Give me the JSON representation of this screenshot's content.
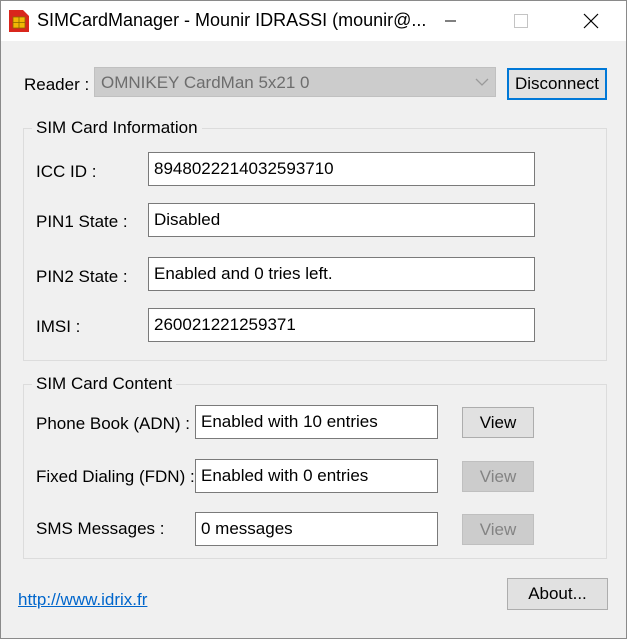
{
  "window": {
    "title": "SIMCardManager - Mounir IDRASSI (mounir@..."
  },
  "reader": {
    "label": "Reader :",
    "selected": "OMNIKEY CardMan 5x21 0",
    "disconnect_label": "Disconnect"
  },
  "sim_info": {
    "group_title": "SIM Card Information",
    "iccid_label": "ICC ID :",
    "iccid_value": "8948022214032593710",
    "pin1_label": "PIN1 State :",
    "pin1_value": "Disabled",
    "pin2_label": "PIN2 State :",
    "pin2_value": "Enabled and 0 tries left.",
    "imsi_label": "IMSI :",
    "imsi_value": "260021221259371"
  },
  "sim_content": {
    "group_title": "SIM Card Content",
    "adn_label": "Phone Book (ADN) :",
    "adn_value": "Enabled with 10 entries",
    "fdn_label": "Fixed Dialing (FDN) :",
    "fdn_value": "Enabled with 0 entries",
    "sms_label": "SMS Messages :",
    "sms_value": "0 messages",
    "view_label": "View"
  },
  "footer": {
    "link_text": "http://www.idrix.fr",
    "about_label": "About..."
  },
  "colors": {
    "window_bg": "#f0f0f0",
    "default_button_border": "#0078d7",
    "link": "#0066cc",
    "app_icon_red": "#d9261c",
    "app_icon_gold": "#f2b705"
  }
}
